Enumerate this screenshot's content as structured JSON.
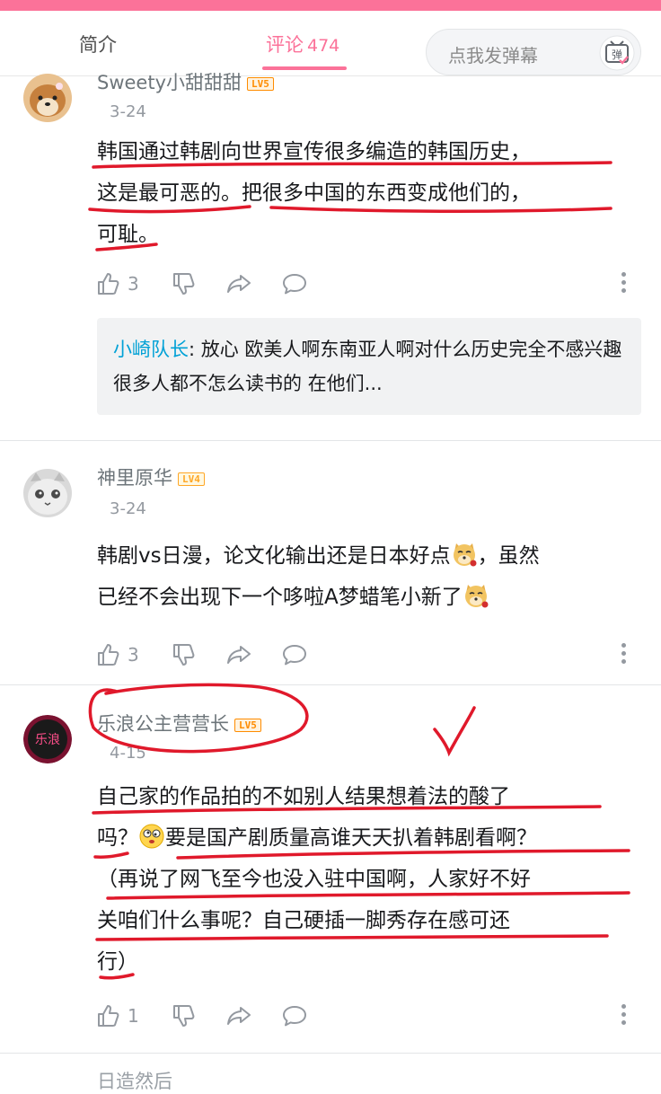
{
  "tabs": {
    "intro": "简介",
    "comments": "评论",
    "comments_count": "474"
  },
  "danmaku": {
    "placeholder": "点我发弹幕",
    "button_icon": "danmaku-send-icon"
  },
  "comments": [
    {
      "user": "Sweety小甜甜甜",
      "level": "LV5",
      "date": "3-24",
      "lines": [
        "韩国通过韩剧向世界宣传很多编造的韩国历史，",
        "这是最可恶的。把很多中国的东西变成他们的，",
        "可耻。"
      ],
      "likes": "3",
      "reply": {
        "author": "小崎队长",
        "text": ": 放心 欧美人啊东南亚人啊对什么历史完全不感兴趣 很多人都不怎么读书的 在他们..."
      }
    },
    {
      "user": "神里原华",
      "level": "LV4",
      "date": "3-24",
      "lines": [
        "韩剧vs日漫，论文化输出还是日本好点",
        "，虽然",
        "已经不会出现下一个哆啦A梦蜡笔小新了"
      ],
      "likes": "3"
    },
    {
      "user": "乐浪公主营营长",
      "level": "LV5",
      "date": "4-15",
      "avatar_text": "乐浪",
      "lines": [
        "自己家的作品拍的不如别人结果想着法的酸了",
        "吗？",
        "要是国产剧质量高谁天天扒着韩剧看啊？",
        "（再说了网飞至今也没入驻中国啊，人家好不好",
        "关咱们什么事呢？自己硬插一脚秀存在感可还",
        "行）"
      ],
      "likes": "1"
    }
  ],
  "partial_next": {
    "user": "日造然后"
  },
  "colors": {
    "accent": "#fb7299",
    "link": "#00a1d6",
    "annotation": "#e0192b"
  }
}
